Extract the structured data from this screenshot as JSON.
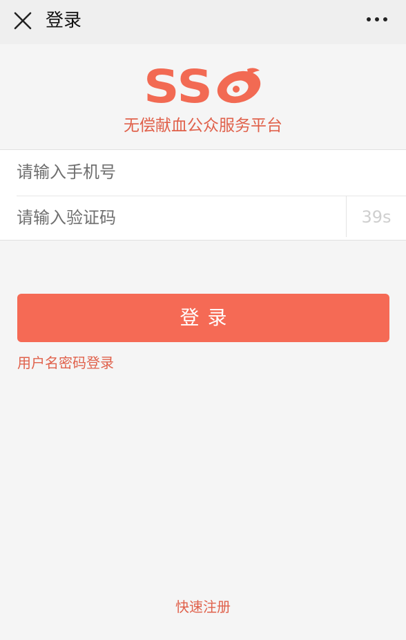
{
  "header": {
    "title": "登录",
    "close_icon": "close-icon",
    "more_icon": "more-icon"
  },
  "logo": {
    "text": "SS",
    "tagline": "无偿献血公众服务平台",
    "brand_color": "#f26a53"
  },
  "form": {
    "phone_placeholder": "请输入手机号",
    "phone_value": "",
    "code_placeholder": "请输入验证码",
    "code_value": "",
    "countdown": "39s"
  },
  "actions": {
    "login_label": "登录",
    "alt_login_label": "用户名密码登录",
    "register_label": "快速注册",
    "accent_color": "#f56a55"
  }
}
